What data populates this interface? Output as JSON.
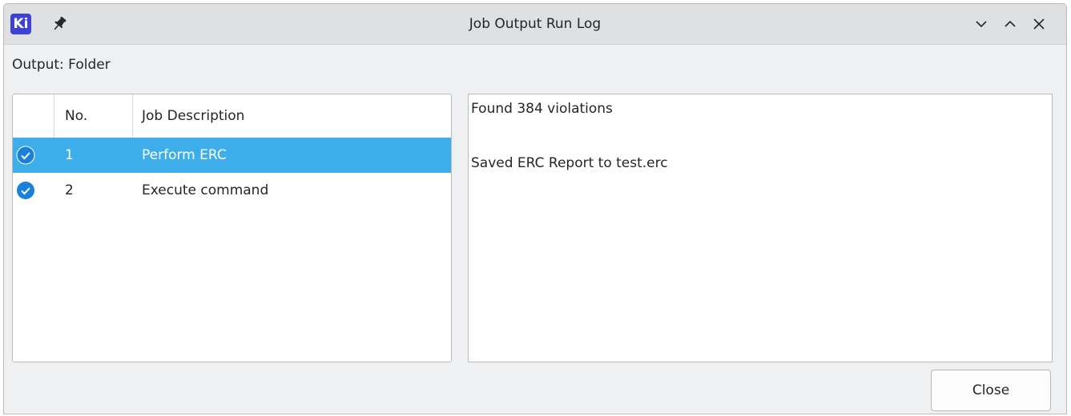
{
  "window": {
    "title": "Job Output Run Log",
    "app_logo_text": "Ki",
    "icons": {
      "pin": "pin-icon",
      "minimize": "chevron-down-icon",
      "maximize": "chevron-up-icon",
      "close": "close-icon"
    }
  },
  "output": {
    "label": "Output: Folder"
  },
  "job_list": {
    "columns": [
      "",
      "No.",
      "Job Description"
    ],
    "rows": [
      {
        "status_icon": "check-circle-icon",
        "number": "1",
        "description": "Perform ERC",
        "selected": true
      },
      {
        "status_icon": "check-circle-icon",
        "number": "2",
        "description": "Execute command",
        "selected": false
      }
    ]
  },
  "log": {
    "lines": [
      "Found 384 violations",
      "Saved ERC Report to test.erc"
    ]
  },
  "buttons": {
    "close_label": "Close"
  },
  "colors": {
    "logo_bg": "#3d41d9",
    "selection": "#3daee9",
    "check_icon": "#1b80d9"
  }
}
